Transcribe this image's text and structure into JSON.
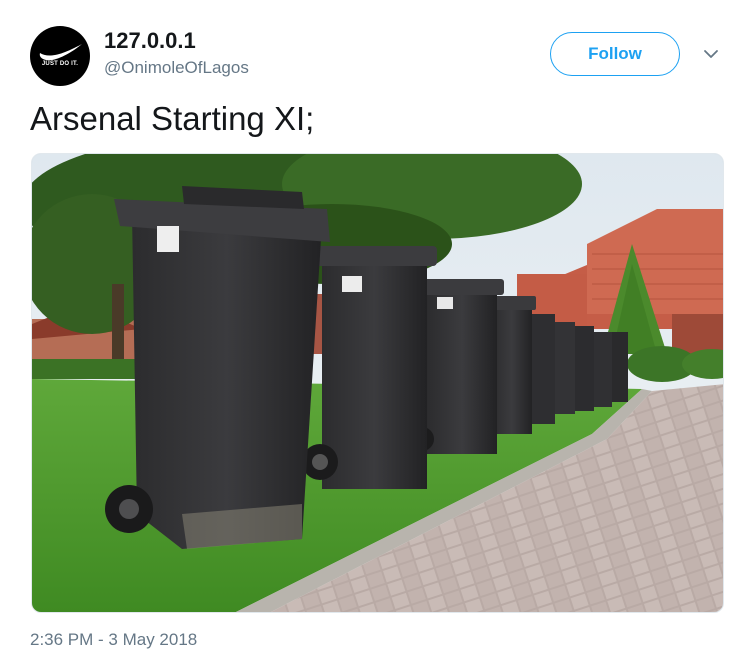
{
  "tweet": {
    "display_name": "127.0.0.1",
    "handle": "@OnimoleOfLagos",
    "avatar_tagline": "JUST DO IT.",
    "follow_label": "Follow",
    "text": "Arsenal Starting XI;",
    "timestamp": "2:36 PM - 3 May 2018"
  },
  "icons": {
    "avatar": "swoosh-logo",
    "menu": "chevron-down-icon"
  },
  "colors": {
    "accent": "#1da1f2",
    "secondary_text": "#657786",
    "primary_text": "#14171a"
  }
}
